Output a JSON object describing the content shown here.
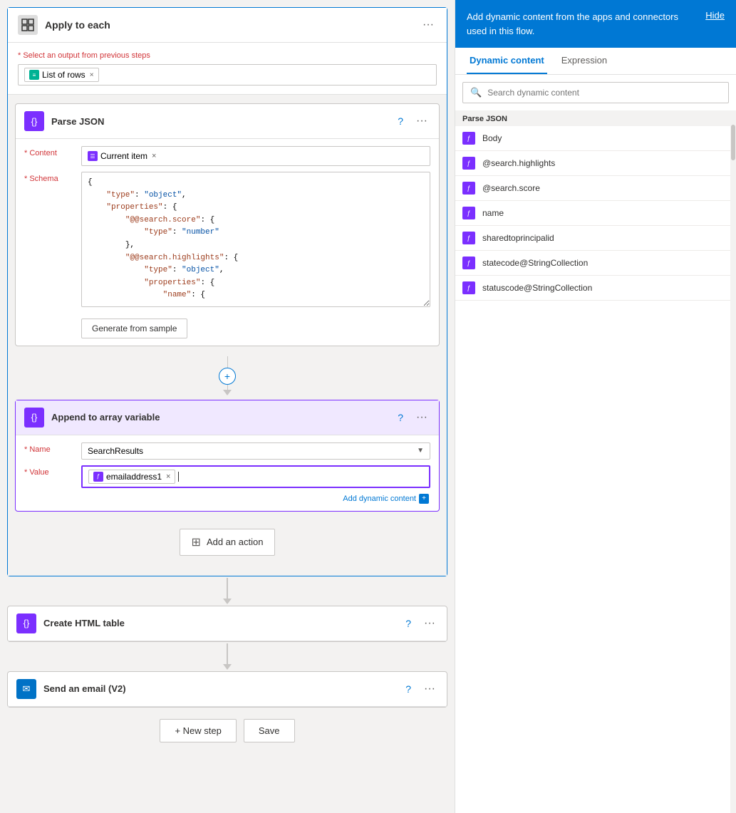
{
  "applyToEach": {
    "title": "Apply to each",
    "selectLabel": "* Select an output from previous steps",
    "tag": "List of rows"
  },
  "parseJSON": {
    "title": "Parse JSON",
    "contentLabel": "Content",
    "contentTag": "Current item",
    "schemaLabel": "Schema",
    "schemaCode": "{\n    \"type\": \"object\",\n    \"properties\": {\n        \"@@search.score\": {\n            \"type\": \"number\"\n        },\n        \"@@search.highlights\": {\n            \"type\": \"object\",\n            \"properties\": {\n                \"name\": {",
    "generateBtn": "Generate from sample"
  },
  "appendArray": {
    "title": "Append to array variable",
    "nameLabel": "Name",
    "nameValue": "SearchResults",
    "valueLabel": "Value",
    "valueTag": "emailaddress1",
    "addDynamic": "Add dynamic content"
  },
  "addAction": {
    "label": "Add an action"
  },
  "createHTMLTable": {
    "title": "Create HTML table"
  },
  "sendEmail": {
    "title": "Send an email (V2)"
  },
  "bottomButtons": {
    "newStep": "+ New step",
    "save": "Save"
  },
  "rightPanel": {
    "headerText": "Add dynamic content from the apps and connectors used in this flow.",
    "hideLabel": "Hide",
    "tabs": [
      "Dynamic content",
      "Expression"
    ],
    "activeTab": "Dynamic content",
    "searchPlaceholder": "Search dynamic content",
    "sectionLabel": "Parse JSON",
    "items": [
      {
        "label": "Body"
      },
      {
        "label": "@search.highlights"
      },
      {
        "label": "@search.score"
      },
      {
        "label": "name"
      },
      {
        "label": "sharedtoprincipalid"
      },
      {
        "label": "statecode@StringCollection"
      },
      {
        "label": "statuscode@StringCollection"
      }
    ]
  },
  "icons": {
    "apply_to_each": "⊡",
    "parse_json": "{}",
    "array_var": "{}",
    "html_table": "{}",
    "email": "✉",
    "tag_icon": "≡",
    "expr_icon": "ƒ",
    "add_action_icon": "⊞",
    "search_icon": "🔍"
  },
  "colors": {
    "blue": "#0078d4",
    "purple": "#7b2fff",
    "green": "#00b294",
    "outlook_blue": "#0072c6",
    "border": "#c8c6c4",
    "text": "#323130"
  }
}
